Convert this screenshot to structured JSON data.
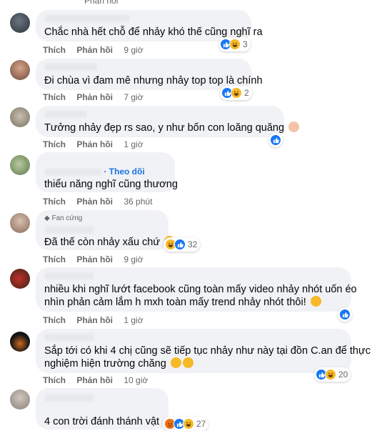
{
  "header": {
    "cut_text": "Phản hồi"
  },
  "actions": {
    "like": "Thích",
    "reply": "Phản hồi"
  },
  "comments": [
    {
      "author_hint": "Nguyen Tu Dieu",
      "text": "Chắc nhà hết chỗ để nhảy khó thế cũng nghĩ ra",
      "time": "9 giờ",
      "reaction_count": "3"
    },
    {
      "author_hint": "Hang Nguyen",
      "text": "Đi chùa vì đam mê nhưng nhảy top top là chính",
      "time": "7 giờ",
      "reaction_count": "2"
    },
    {
      "author_hint": "",
      "text": "Tưởng nhảy đẹp rs sao, y như bốn con loăng quăng",
      "time": "1 giờ",
      "reaction_count": ""
    },
    {
      "author_hint": "",
      "follow": "· Theo dõi",
      "text": "thiểu năng nghĩ cũng thương",
      "time": "36 phút",
      "reaction_count": ""
    },
    {
      "author_hint": "",
      "badge": "Fan cứng",
      "text": "Đã thế còn nhảy xấu chứ",
      "time": "9 giờ",
      "reaction_count": "32"
    },
    {
      "author_hint": "",
      "text_line1": "nhiều khi nghĩ lướt facebook cũng toàn mấy video nhảy nhót uốn éo",
      "text_line2": "nhìn phản cảm lắm h mxh toàn mấy trend nhảy nhót thôi!",
      "time": "1 giờ",
      "reaction_count": ""
    },
    {
      "author_hint": "",
      "text_line1": "Sắp tới có khi 4 chị cũng sẽ tiếp tục nhảy như này tại đồn C.an để thực",
      "text_line2": "nghiệm hiện trường chăng",
      "time": "10 giờ",
      "reaction_count": "20"
    },
    {
      "author_hint": "",
      "text": "4 con trời đánh thánh vật",
      "time": "",
      "reaction_count": "27"
    }
  ],
  "colors": {
    "bubble": "#f0f2f5",
    "meta": "#65676b",
    "link": "#1b74e4",
    "like": "#1877f2",
    "haha": "#f7b928"
  }
}
